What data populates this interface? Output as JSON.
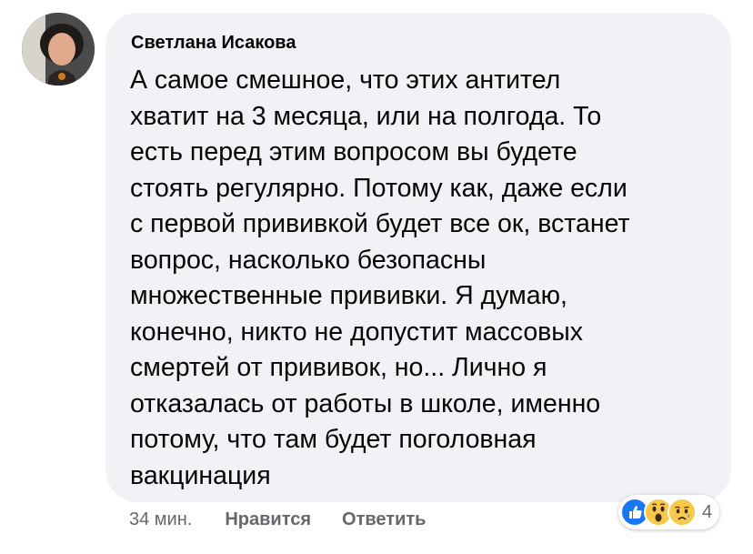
{
  "comment": {
    "author": "Светлана Исакова",
    "lines": [
      "А самое смешное, что этих антител",
      "хватит на 3 месяца, или на полгода. То",
      "есть перед этим вопросом вы будете",
      "стоять регулярно. Потому как, даже если",
      "с первой прививкой будет все ок, встанет",
      "вопрос, насколько безопасны",
      "множественные прививки. Я думаю,",
      "конечно, никто не допустит массовых",
      "смертей от прививок, но... Лично я",
      "отказалась от работы в школе, именно",
      "потому, что там будет поголовная",
      "вакцинация"
    ]
  },
  "actions": {
    "time": "34 мин.",
    "like_label": "Нравится",
    "reply_label": "Ответить"
  },
  "reactions": {
    "icons": [
      "like-icon",
      "wow-icon",
      "sad-icon"
    ],
    "count": "4"
  },
  "colors": {
    "bubble": "#f0f2f5",
    "text": "#050505",
    "meta": "#65676b",
    "like_blue": "#1877f2",
    "emoji_yellow": "#f7c84a"
  }
}
